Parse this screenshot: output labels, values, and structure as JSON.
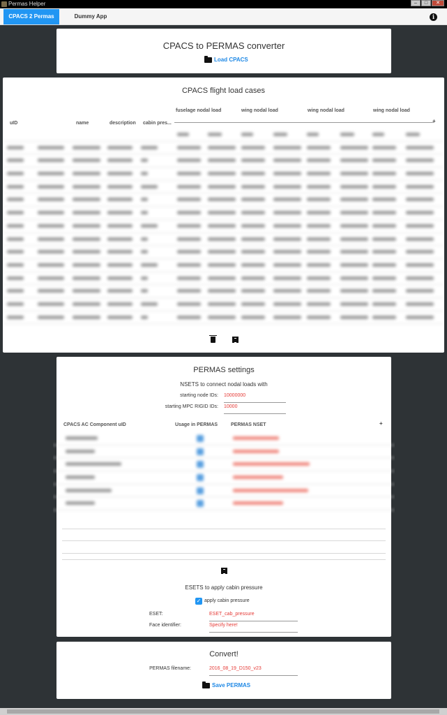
{
  "window": {
    "title": "Permas Helper"
  },
  "tabs": [
    {
      "label": "CPACS 2 Permas",
      "active": true
    },
    {
      "label": "Dummy App",
      "active": false
    }
  ],
  "colors": {
    "accent": "#2196f3",
    "field_value": "#e53935",
    "background": "#2e3336"
  },
  "icons": {
    "info": "info-icon",
    "folder": "folder-icon",
    "trash": "trash-icon",
    "list": "list-icon",
    "plus": "plus-icon"
  },
  "converter": {
    "title": "CPACS to PERMAS converter",
    "load_label": "Load CPACS"
  },
  "flight_loads": {
    "title": "CPACS flight load cases",
    "columns": [
      "uID",
      "name",
      "description",
      "cabin pres..."
    ],
    "groups": [
      "fuselage nodal load",
      "wing nodal load",
      "wing nodal load",
      "wing nodal load"
    ],
    "add_symbol": "+"
  },
  "permas": {
    "title": "PERMAS settings",
    "nsets_title": "NSETS to connect nodal loads with",
    "starting_node_label": "starting node IDs:",
    "starting_node_value": "10000000",
    "starting_mpc_label": "starting MPC RIGID IDs:",
    "starting_mpc_value": "10000",
    "columns": [
      "CPACS AC Component uID",
      "Usage in PERMAS",
      "PERMAS NSET"
    ],
    "add_symbol": "+",
    "esets_title": "ESETS to apply cabin pressure",
    "apply_label": "apply cabin pressure",
    "apply_checked": true,
    "eset_label": "ESET:",
    "eset_value": "ESET_cab_pressure",
    "face_label": "Face identifier:",
    "face_value": "Specify here!"
  },
  "convert": {
    "title": "Convert!",
    "filename_label": "PERMAS filename:",
    "filename_value": "2016_08_19_D150_v23",
    "save_label": "Save PERMAS"
  }
}
